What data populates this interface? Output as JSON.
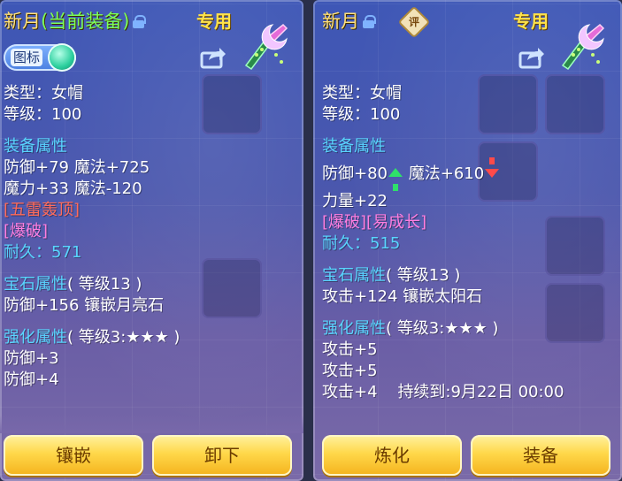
{
  "left": {
    "title": "新月",
    "title_sub": "(当前装备)",
    "exclusive": "专用",
    "toggle_label": "图标",
    "type": "类型：女帽",
    "level": "等级：100",
    "equip_section": "装备属性",
    "stat_line1": "防御+79 魔法+725",
    "stat_line2": "魔力+33 魔法-120",
    "special1": "[五雷轰顶]",
    "special2": "[爆破]",
    "durability_label": "耐久：",
    "durability_value": "571",
    "gem_section": "宝石属性",
    "gem_level": "( 等级13 )",
    "gem_line": "防御+156 镶嵌月亮石",
    "forge_section": "强化属性",
    "forge_level": "( 等级3:★★★ )",
    "forge_line1": "防御+3",
    "forge_line2": "防御+4",
    "btn1": "镶嵌",
    "btn2": "卸下"
  },
  "right": {
    "title": "新月",
    "rating": "评",
    "exclusive": "专用",
    "type": "类型：女帽",
    "level": "等级：100",
    "equip_section": "装备属性",
    "stat_def": "防御+80",
    "stat_magic": "魔法+610",
    "stat_line2": "力量+22",
    "special": "[爆破][易成长]",
    "durability_label": "耐久：",
    "durability_value": "515",
    "gem_section": "宝石属性",
    "gem_level": "( 等级13 )",
    "gem_line": "攻击+124 镶嵌太阳石",
    "forge_section": "强化属性",
    "forge_level": "( 等级3:★★★ )",
    "forge_line1": "攻击+5",
    "forge_line2": "攻击+5",
    "forge_line3": "攻击+4",
    "forge_duration": "持续到:9月22日 00:00",
    "btn1": "炼化",
    "btn2": "装备"
  },
  "colors": {
    "title": "#ffe07a",
    "title_sub": "#7dff5a",
    "section": "#59d5ff",
    "special_red": "#ff6b5a",
    "special_pink": "#ff7ee0",
    "button": "#ffd84a"
  },
  "icons": [
    "lock-icon",
    "rating-icon",
    "share-icon",
    "hat-item-icon",
    "up-arrow-icon",
    "down-arrow-icon"
  ]
}
